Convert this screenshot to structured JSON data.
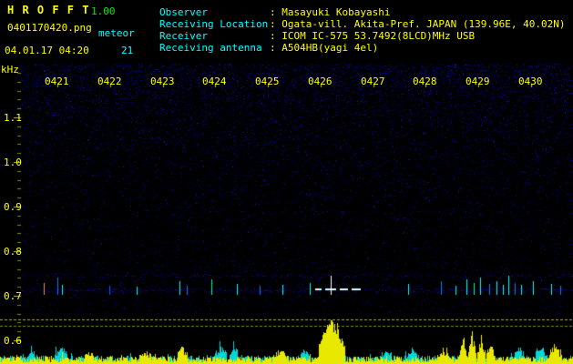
{
  "header": {
    "title": "H R O F F T",
    "version": "1.00",
    "filename": "0401170420.png",
    "mode": "meteor",
    "count": "21",
    "datetime": "04.01.17 04:20",
    "info": [
      {
        "label": "Observer",
        "value": ": Masayuki Kobayashi"
      },
      {
        "label": "Receiving Location",
        "value": ": Ogata-vill. Akita-Pref. JAPAN (139.96E, 40.02N)"
      },
      {
        "label": "Receiver",
        "value": ": ICOM IC-575 53.7492(8LCD)MHz USB"
      },
      {
        "label": "Receiving antenna",
        "value": ": A504HB(yagi 4el)"
      }
    ]
  },
  "axes": {
    "freq_unit": "kHz",
    "time_labels": [
      "0421",
      "0422",
      "0423",
      "0424",
      "0425",
      "0426",
      "0427",
      "0428",
      "0429",
      "0430"
    ],
    "freq_labels": [
      "1.1",
      "1.0",
      "0.9",
      "0.8",
      "0.7",
      "0.6"
    ]
  },
  "colors": {
    "background": "#000000",
    "axis_label": "#ffff00",
    "info_label": "#00ffff",
    "version": "#00ee00",
    "tick": "#cccc00",
    "minor_tick": "#8a8a00",
    "noise": [
      "#00006a",
      "#000092",
      "#1a1a8c",
      "#0000e0"
    ],
    "level_yellow": "#e8e800",
    "level_cyan": "#00d8d8",
    "echo_bright": "#e0ffff",
    "frame_line": "#b8b800",
    "frame_line_dim": "#8a8a00"
  },
  "plot": {
    "seed": 20040117,
    "echo_dashes": [
      [
        346,
        353
      ],
      [
        357,
        369
      ],
      [
        373,
        382
      ],
      [
        386,
        396
      ]
    ],
    "band_ticks": [
      [
        48,
        10,
        "#ff8080"
      ],
      [
        63,
        16,
        "#0080ff"
      ],
      [
        68,
        8,
        "#00ffff"
      ],
      [
        120,
        7,
        "#0060ff"
      ],
      [
        150,
        6,
        "#00ffff"
      ],
      [
        197,
        12,
        "#00ffff"
      ],
      [
        205,
        7,
        "#0080ff"
      ],
      [
        232,
        14,
        "#00ff80"
      ],
      [
        260,
        9,
        "#00ffff"
      ],
      [
        285,
        7,
        "#0080ff"
      ],
      [
        310,
        8,
        "#00ffff"
      ],
      [
        340,
        10,
        "#00ffff"
      ],
      [
        363,
        18,
        "#ffffff"
      ],
      [
        448,
        9,
        "#00ffff"
      ],
      [
        484,
        12,
        "#0080ff"
      ],
      [
        500,
        7,
        "#00ffff"
      ],
      [
        512,
        14,
        "#00ffff"
      ],
      [
        520,
        10,
        "#00ff80"
      ],
      [
        527,
        16,
        "#00ffff"
      ],
      [
        537,
        9,
        "#0080ff"
      ],
      [
        545,
        12,
        "#00ffff"
      ],
      [
        552,
        8,
        "#00ffff"
      ],
      [
        558,
        18,
        "#00ffff"
      ],
      [
        565,
        10,
        "#0080ff"
      ],
      [
        572,
        8,
        "#00ffff"
      ],
      [
        585,
        12,
        "#00ffff"
      ],
      [
        605,
        9,
        "#00ffff"
      ],
      [
        615,
        7,
        "#0080ff"
      ]
    ],
    "level_peaks": [
      [
        350,
        378,
        42,
        "y"
      ],
      [
        504,
        512,
        20,
        "y"
      ],
      [
        514,
        522,
        26,
        "y"
      ],
      [
        524,
        532,
        22,
        "y"
      ],
      [
        534,
        542,
        16,
        "y"
      ],
      [
        236,
        248,
        13,
        "c"
      ],
      [
        252,
        262,
        11,
        "c"
      ],
      [
        60,
        74,
        13,
        "c"
      ],
      [
        194,
        206,
        11,
        "y"
      ],
      [
        300,
        316,
        9,
        "y"
      ],
      [
        418,
        430,
        8,
        "c"
      ],
      [
        588,
        600,
        13,
        "c"
      ],
      [
        602,
        616,
        14,
        "y"
      ],
      [
        154,
        166,
        9,
        "y"
      ],
      [
        28,
        40,
        8,
        "c"
      ],
      [
        92,
        102,
        8,
        "y"
      ],
      [
        330,
        340,
        8,
        "c"
      ],
      [
        448,
        458,
        10,
        "c"
      ],
      [
        480,
        492,
        10,
        "y"
      ],
      [
        564,
        574,
        11,
        "c"
      ]
    ]
  }
}
